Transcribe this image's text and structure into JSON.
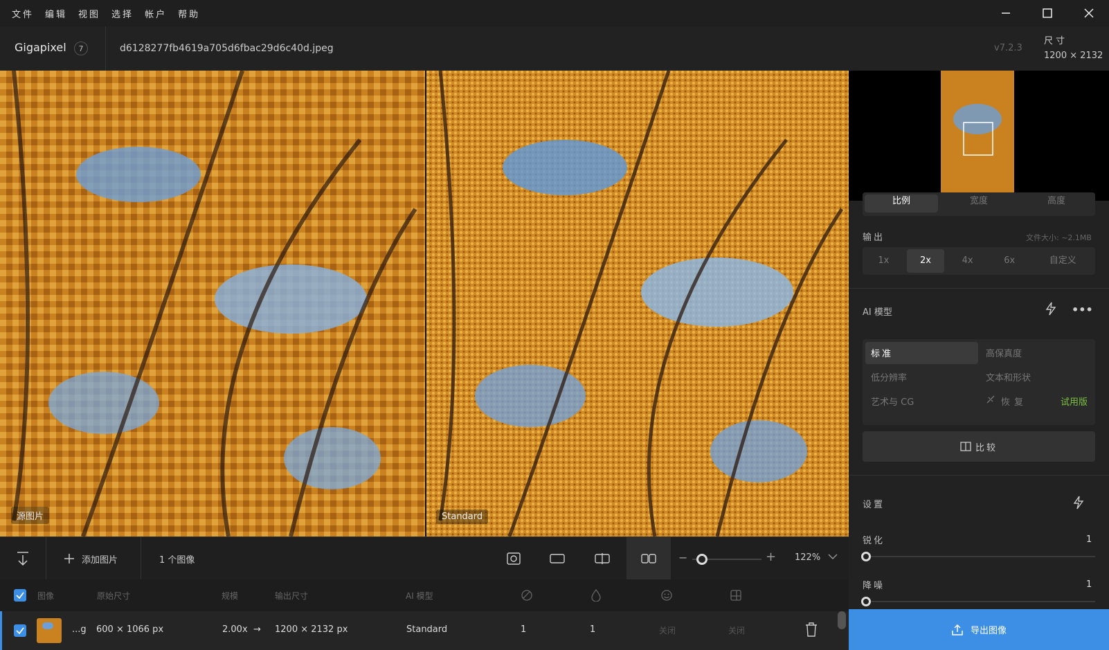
{
  "menu": [
    "文件",
    "编辑",
    "视图",
    "选择",
    "帐户",
    "帮助"
  ],
  "header": {
    "app_name": "Gigapixel",
    "count": "7",
    "filename": "d6128277fb4619a705d6fbac29d6c40d.jpeg",
    "version": "v7.2.3",
    "size_label": "尺寸",
    "size_value": "1200 × 2132"
  },
  "viewer": {
    "left_tag": "源图片",
    "right_tag": "Standard"
  },
  "panel": {
    "dim_tabs": [
      "比例",
      "宽度",
      "高度"
    ],
    "output_label": "输出",
    "file_size": "文件大小: ~2.1MB",
    "scale_options": [
      "1x",
      "2x",
      "4x",
      "6x",
      "自定义"
    ],
    "ai_label": "AI 模型",
    "models": {
      "standard": "标准",
      "high_fidelity": "高保真度",
      "low_res": "低分辨率",
      "text_shape": "文本和形状",
      "art_cg": "艺术与 CG",
      "recover": "恢复",
      "trial": "试用版"
    },
    "compare": "比较",
    "settings_label": "设置",
    "sharpen_label": "锐化",
    "sharpen_value": "1",
    "denoise_label": "降噪",
    "denoise_value": "1",
    "export": "导出图像"
  },
  "toolbar": {
    "add": "添加图片",
    "count": "1 个图像",
    "zoom": "122%"
  },
  "table": {
    "headers": {
      "image": "图像",
      "orig": "原始尺寸",
      "scale": "规模",
      "out": "输出尺寸",
      "model": "AI 模型"
    },
    "row": {
      "name": "...g",
      "orig": "600 × 1066 px",
      "scale": "2.00x",
      "arrow": "→",
      "out": "1200 × 2132 px",
      "model": "Standard",
      "v1": "1",
      "v2": "1",
      "v3": "关闭",
      "v4": "关闭"
    }
  },
  "colors": {
    "accent": "#3d8fe6",
    "trial": "#7cc142"
  }
}
